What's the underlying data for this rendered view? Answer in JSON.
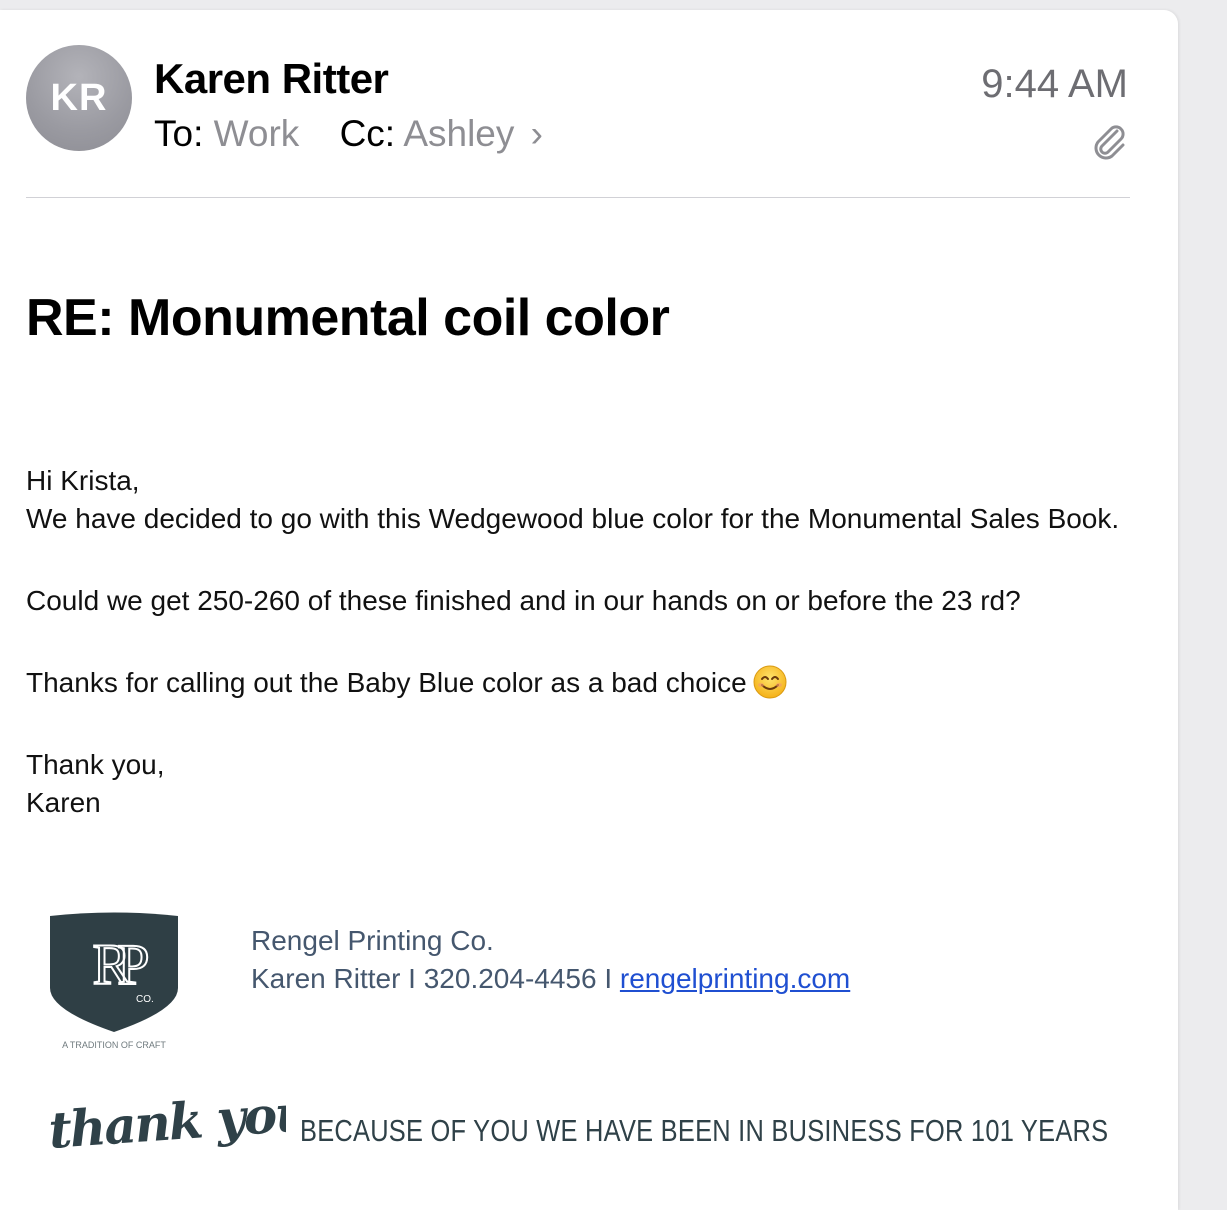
{
  "header": {
    "avatar_initials": "KR",
    "sender_name": "Karen Ritter",
    "to_label": "To:",
    "to_value": "Work",
    "cc_label": "Cc:",
    "cc_value": "Ashley",
    "chevron": "›",
    "time": "9:44 AM",
    "attachment_icon": "paperclip-icon"
  },
  "email": {
    "subject": "RE: Monumental coil color",
    "greeting": "Hi Krista,",
    "paragraph1": "We have decided to go with this Wedgewood blue color for the Monumental Sales Book.",
    "paragraph2": "Could we get 250-260 of these finished and in our hands on or before the 23 rd?",
    "paragraph3": "Thanks for calling out the Baby Blue color as a bad choice",
    "emoji": "smiling-face-emoji",
    "closing": "Thank you,",
    "signoff": "Karen"
  },
  "signature": {
    "company": "Rengel Printing Co.",
    "contact_prefix": "Karen Ritter I 320.204-4456 I",
    "website": "rengelprinting.com",
    "logo_tagline": "A TRADITION OF CRAFT",
    "logo_letters": "RP",
    "logo_co": "CO.",
    "thank_you_script": "thank you",
    "banner_text": "BECAUSE OF YOU WE HAVE BEEN IN BUSINESS FOR 101 YEARS"
  },
  "colors": {
    "logo_shield": "#2f3f45",
    "muted_gray": "#8e8e93",
    "signature_text": "#45576e",
    "link": "#1f4fd1"
  }
}
